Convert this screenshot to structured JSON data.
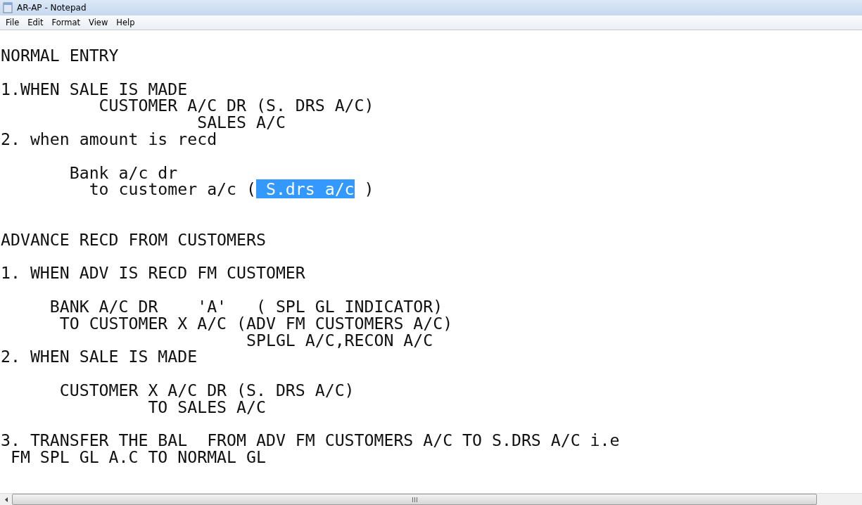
{
  "window": {
    "title": "AR-AP - Notepad"
  },
  "menu": [
    {
      "label": "File"
    },
    {
      "label": "Edit"
    },
    {
      "label": "Format"
    },
    {
      "label": "View"
    },
    {
      "label": "Help"
    }
  ],
  "lines": [
    {
      "kind": "text",
      "segments": [
        {
          "text": "NORMAL ENTRY",
          "selected": false
        }
      ]
    },
    {
      "kind": "blank"
    },
    {
      "kind": "text",
      "segments": [
        {
          "text": "1.WHEN SALE IS MADE",
          "selected": false
        }
      ]
    },
    {
      "kind": "text",
      "segments": [
        {
          "text": "          CUSTOMER A/C DR (S. DRS A/C)",
          "selected": false
        }
      ]
    },
    {
      "kind": "text",
      "segments": [
        {
          "text": "                    SALES A/C",
          "selected": false
        }
      ]
    },
    {
      "kind": "text",
      "segments": [
        {
          "text": "2. when amount is recd",
          "selected": false
        }
      ]
    },
    {
      "kind": "blank"
    },
    {
      "kind": "text",
      "segments": [
        {
          "text": "       Bank a/c dr",
          "selected": false
        }
      ]
    },
    {
      "kind": "text",
      "segments": [
        {
          "text": "         to customer a/c (",
          "selected": false
        },
        {
          "text": " S.drs a/c",
          "selected": true
        },
        {
          "text": " )",
          "selected": false
        }
      ]
    },
    {
      "kind": "blank"
    },
    {
      "kind": "blank"
    },
    {
      "kind": "text",
      "segments": [
        {
          "text": "ADVANCE RECD FROM CUSTOMERS",
          "selected": false
        }
      ]
    },
    {
      "kind": "blank"
    },
    {
      "kind": "text",
      "segments": [
        {
          "text": "1. WHEN ADV IS RECD FM CUSTOMER",
          "selected": false
        }
      ]
    },
    {
      "kind": "blank"
    },
    {
      "kind": "text",
      "segments": [
        {
          "text": "     BANK A/C DR    'A'   ( SPL GL INDICATOR)",
          "selected": false
        }
      ]
    },
    {
      "kind": "text",
      "segments": [
        {
          "text": "      TO CUSTOMER X A/C (ADV FM CUSTOMERS A/C)",
          "selected": false
        }
      ]
    },
    {
      "kind": "text",
      "segments": [
        {
          "text": "                         SPLGL A/C,RECON A/C",
          "selected": false
        }
      ]
    },
    {
      "kind": "text",
      "segments": [
        {
          "text": "2. WHEN SALE IS MADE",
          "selected": false
        }
      ]
    },
    {
      "kind": "blank"
    },
    {
      "kind": "text",
      "segments": [
        {
          "text": "      CUSTOMER X A/C DR (S. DRS A/C)",
          "selected": false
        }
      ]
    },
    {
      "kind": "text",
      "segments": [
        {
          "text": "               TO SALES A/C",
          "selected": false
        }
      ]
    },
    {
      "kind": "blank"
    },
    {
      "kind": "text",
      "segments": [
        {
          "text": "3. TRANSFER THE BAL  FROM ADV FM CUSTOMERS A/C TO S.DRS A/C i.e",
          "selected": false
        }
      ]
    },
    {
      "kind": "text",
      "segments": [
        {
          "text": " FM SPL GL A.C TO NORMAL GL",
          "selected": false
        }
      ]
    }
  ]
}
